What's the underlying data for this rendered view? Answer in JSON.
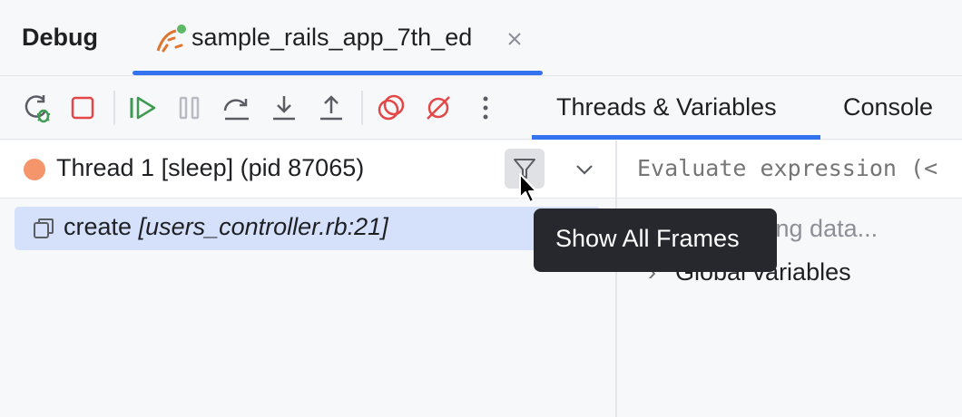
{
  "header": {
    "title": "Debug",
    "run_tab_label": "sample_rails_app_7th_ed"
  },
  "toolbar": {
    "buttons": [
      "rerun-icon",
      "stop-icon",
      "resume-icon",
      "pause-icon",
      "step-over-icon",
      "step-into-icon",
      "step-out-icon",
      "view-breakpoints-icon",
      "mute-breakpoints-icon",
      "more-icon"
    ],
    "tabs": [
      "Threads & Variables",
      "Console"
    ],
    "active_tab": "Threads & Variables"
  },
  "threads": {
    "current_thread": "Thread 1 [sleep] (pid 87065)",
    "frames": [
      {
        "method": "create",
        "location": "[users_controller.rb:21]"
      }
    ]
  },
  "variables": {
    "evaluate_placeholder": "Evaluate expression (<",
    "status": "Collecting data...",
    "global_label": "Global variables"
  },
  "tooltip": {
    "text": "Show All Frames"
  },
  "colors": {
    "accent": "#3574f0",
    "thread_dot": "#f5956b",
    "selection": "#d5e1fb",
    "tooltip_bg": "#27282e"
  }
}
